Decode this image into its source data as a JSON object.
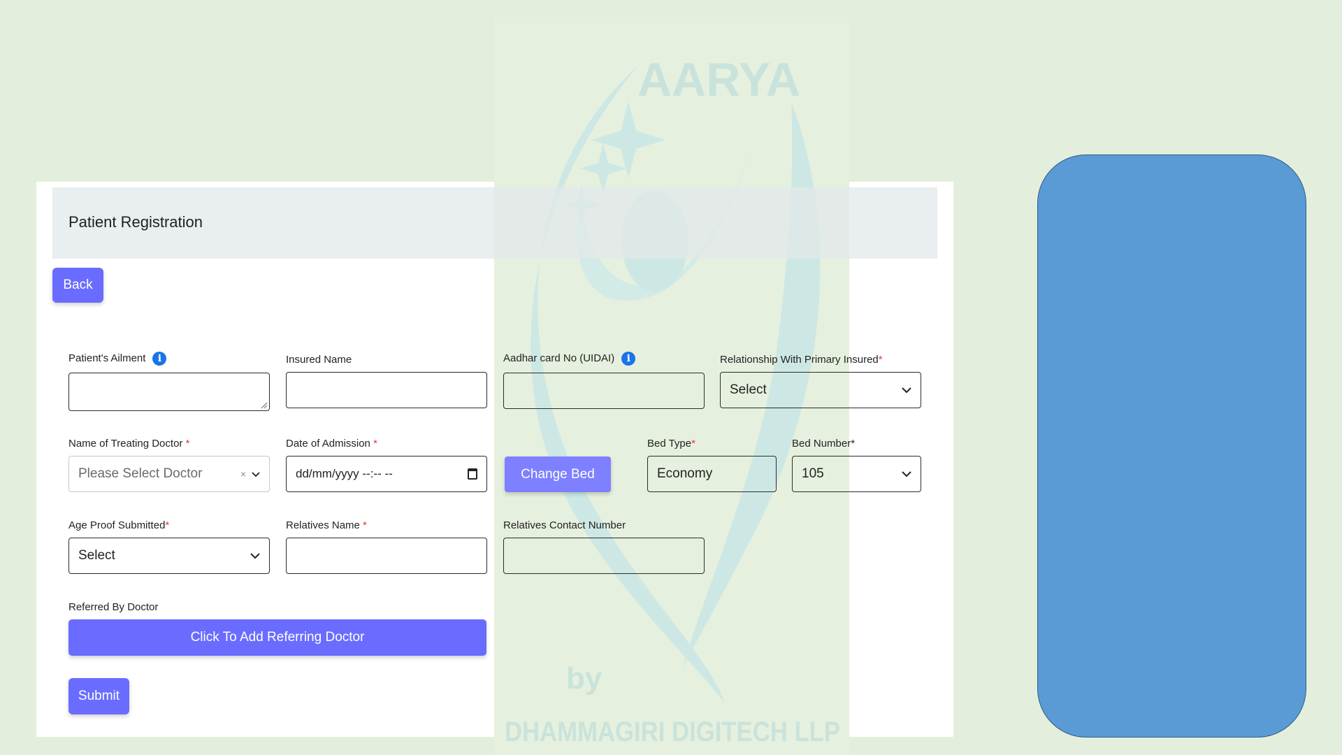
{
  "page": {
    "title": "Patient Registration",
    "back_label": "Back"
  },
  "watermark": {
    "brand": "AARYA",
    "by": "by",
    "company": "DHAMMAGIRI DIGITECH LLP"
  },
  "form": {
    "ailment_label": "Patient's Ailment",
    "insured_name_label": "Insured Name",
    "aadhar_label": "Aadhar card No (UIDAI)",
    "relationship_label": "Relationship With Primary Insured",
    "relationship_value": "Select",
    "doctor_label": "Name of Treating Doctor",
    "doctor_placeholder": "Please Select Doctor",
    "admission_label": "Date of Admission",
    "admission_placeholder": "dd/mm/yyyy --:-- --",
    "change_bed_label": "Change Bed",
    "bed_type_label": "Bed Type",
    "bed_type_value": "Economy",
    "bed_number_label": "Bed Number",
    "bed_number_value": "105",
    "age_proof_label": "Age Proof Submitted",
    "age_proof_value": "Select",
    "relatives_name_label": "Relatives Name",
    "relatives_contact_label": "Relatives Contact Number",
    "referred_by_label": "Referred By Doctor",
    "add_referring_label": "Click To Add Referring Doctor",
    "submit_label": "Submit",
    "required_mark": "*",
    "info_glyph": "i",
    "clear_glyph": "×"
  },
  "icons": [
    "info-icon",
    "chevron-down-icon",
    "calendar-icon",
    "clear-icon"
  ],
  "colors": {
    "accent": "#6a6cff",
    "info": "#1a73e8",
    "background": "#e3efdc",
    "side_panel": "#5b9bd5",
    "required": "#e53935"
  }
}
